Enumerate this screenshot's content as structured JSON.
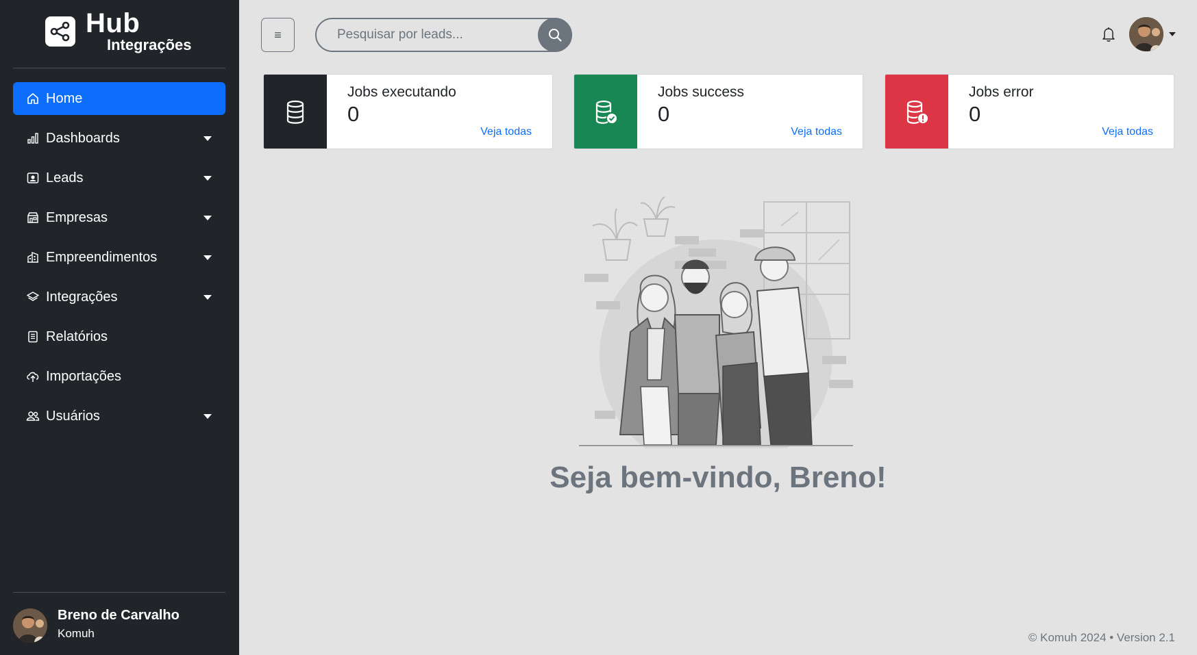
{
  "brand": {
    "title": "Hub",
    "subtitle": "Integrações"
  },
  "sidebar": {
    "items": [
      {
        "label": "Home",
        "icon": "home-icon",
        "active": true,
        "has_caret": false
      },
      {
        "label": "Dashboards",
        "icon": "bar-chart-icon",
        "has_caret": true
      },
      {
        "label": "Leads",
        "icon": "person-badge-icon",
        "has_caret": true
      },
      {
        "label": "Empresas",
        "icon": "shop-icon",
        "has_caret": true
      },
      {
        "label": "Empreendimentos",
        "icon": "buildings-icon",
        "has_caret": true
      },
      {
        "label": "Integrações",
        "icon": "layers-icon",
        "has_caret": true
      },
      {
        "label": "Relatórios",
        "icon": "document-icon",
        "has_caret": false
      },
      {
        "label": "Importações",
        "icon": "cloud-upload-icon",
        "has_caret": false
      },
      {
        "label": "Usuários",
        "icon": "people-icon",
        "has_caret": true
      }
    ]
  },
  "profile": {
    "name": "Breno de Carvalho",
    "company": "Komuh"
  },
  "topbar": {
    "menu_icon": "≡",
    "search_placeholder": "Pesquisar por leads..."
  },
  "cards": [
    {
      "title": "Jobs executando",
      "value": "0",
      "link": "Veja todas",
      "color": "#212529",
      "icon": "database-icon"
    },
    {
      "title": "Jobs success",
      "value": "0",
      "link": "Veja todas",
      "color": "#198754",
      "icon": "database-check-icon"
    },
    {
      "title": "Jobs error",
      "value": "0",
      "link": "Veja todas",
      "color": "#dc3545",
      "icon": "database-exclamation-icon"
    }
  ],
  "welcome": "Seja bem-vindo, Breno!",
  "footer": "© Komuh 2024 • Version 2.1"
}
